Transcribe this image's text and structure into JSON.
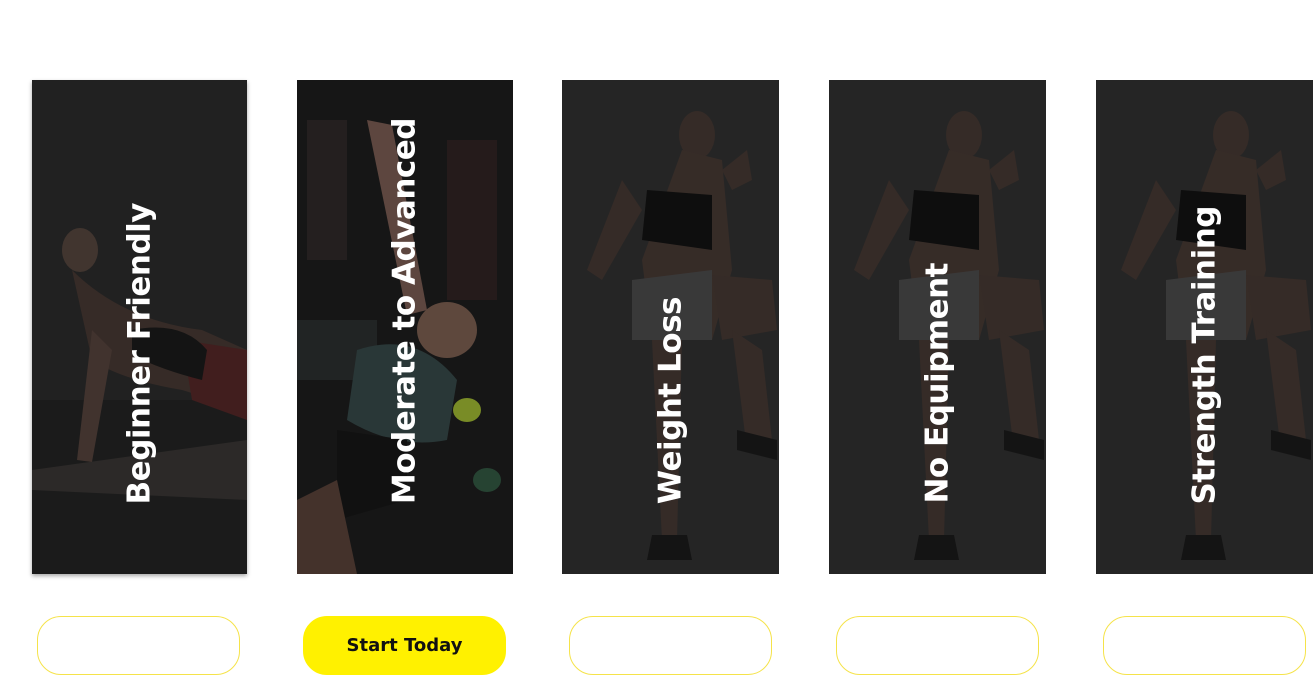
{
  "cards": [
    {
      "label": "Beginner Friendly",
      "button_label": ""
    },
    {
      "label": "Moderate to Advanced",
      "button_label": "Start Today"
    },
    {
      "label": "Weight Loss",
      "button_label": ""
    },
    {
      "label": "No Equipment",
      "button_label": ""
    },
    {
      "label": "Strength Training",
      "button_label": ""
    }
  ],
  "colors": {
    "accent": "#fff100",
    "button_border": "#f5e34a",
    "card_overlay": "#3a3a3a",
    "label_text": "#ffffff"
  }
}
